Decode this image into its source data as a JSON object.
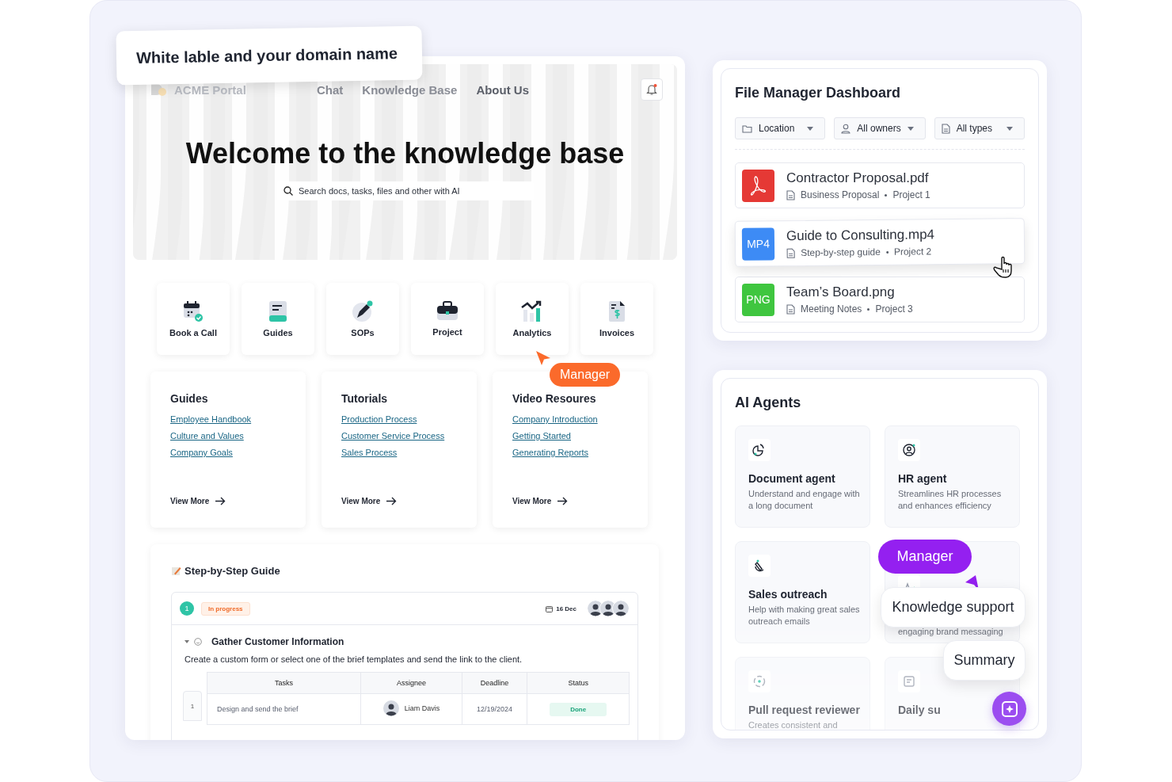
{
  "callout": {
    "text": "White lable and your domain name"
  },
  "portal": {
    "brand": "ACME Portal",
    "nav": [
      "Chat",
      "Knowledge Base",
      "About Us"
    ],
    "title": "Welcome to the knowledge base",
    "search": {
      "placeholder": "Search docs, tasks, files and other with AI"
    },
    "tiles": [
      {
        "label": "Book a Call",
        "kind": "calendar"
      },
      {
        "label": "Guides",
        "kind": "book"
      },
      {
        "label": "SOPs",
        "kind": "pen"
      },
      {
        "label": "Project",
        "kind": "briefcase"
      },
      {
        "label": "Analytics",
        "kind": "chart"
      },
      {
        "label": "Invoices",
        "kind": "invoice"
      }
    ],
    "cards": [
      {
        "title": "Guides",
        "links": [
          "Employee Handbook",
          "Culture and Values",
          "Company Goals"
        ],
        "more": "View More"
      },
      {
        "title": "Tutorials",
        "links": [
          "Production Process",
          "Customer Service Process",
          "Sales Process"
        ],
        "more": "View More"
      },
      {
        "title": "Video Resoures",
        "links": [
          "Company Introduction",
          "Getting Started",
          "Generating Reports"
        ],
        "more": "View More"
      }
    ],
    "guide": {
      "title": "Step-by-Step Guide",
      "step": "1",
      "status": "In progress",
      "date": "16 Dec",
      "section": "Gather Customer Information",
      "description": "Create a custom form or select one of the brief templates and send the link to the client.",
      "columns": [
        "Tasks",
        "Assignee",
        "Deadline",
        "Status"
      ],
      "rows": [
        {
          "number": "1",
          "task": "Design and send the brief",
          "assignee": "Liam Davis",
          "deadline": "12/19/2024",
          "status": "Done"
        }
      ]
    }
  },
  "manager_badge_orange": {
    "text": "Manager"
  },
  "file_manager": {
    "title": "File Manager Dashboard",
    "filters": [
      {
        "label": "Location",
        "kind": "folder"
      },
      {
        "label": "All owners",
        "kind": "person"
      },
      {
        "label": "All types",
        "kind": "file"
      }
    ],
    "files": [
      {
        "name": "Contractor Proposal.pdf",
        "kind": "pdf",
        "color": "#e53935",
        "category": "Business Proposal",
        "project": "Project 1",
        "raised": false
      },
      {
        "name": "Guide to Consulting.mp4",
        "kind": "label",
        "badge": "MP4",
        "color": "#3d8bf5",
        "category": "Step-by-step guide",
        "project": "Project 2",
        "raised": true
      },
      {
        "name": "Team’s Board.png",
        "kind": "label",
        "badge": "PNG",
        "color": "#3fc63f",
        "category": "Meeting Notes",
        "project": "Project 3",
        "raised": false
      }
    ]
  },
  "ai_agents": {
    "title": "AI Agents",
    "agents": [
      {
        "kind": "doc",
        "title": "Document agent",
        "description": "Understand and engage with a long document"
      },
      {
        "kind": "person",
        "title": "HR agent",
        "description": "Streamlines HR processes and enhances efficiency"
      },
      {
        "kind": "pen",
        "title": "Sales outreach",
        "description": "Help with making great sales outreach emails"
      },
      {
        "kind": "brand",
        "description": "engaging brand messaging"
      },
      {
        "kind": "ring",
        "title": "Pull request reviewer",
        "description": "Creates consistent and"
      },
      {
        "kind": "note",
        "title": "Daily su"
      }
    ]
  },
  "manager_badge_purple": {
    "text": "Manager"
  },
  "popups": [
    "Knowledge support",
    "Summary"
  ]
}
